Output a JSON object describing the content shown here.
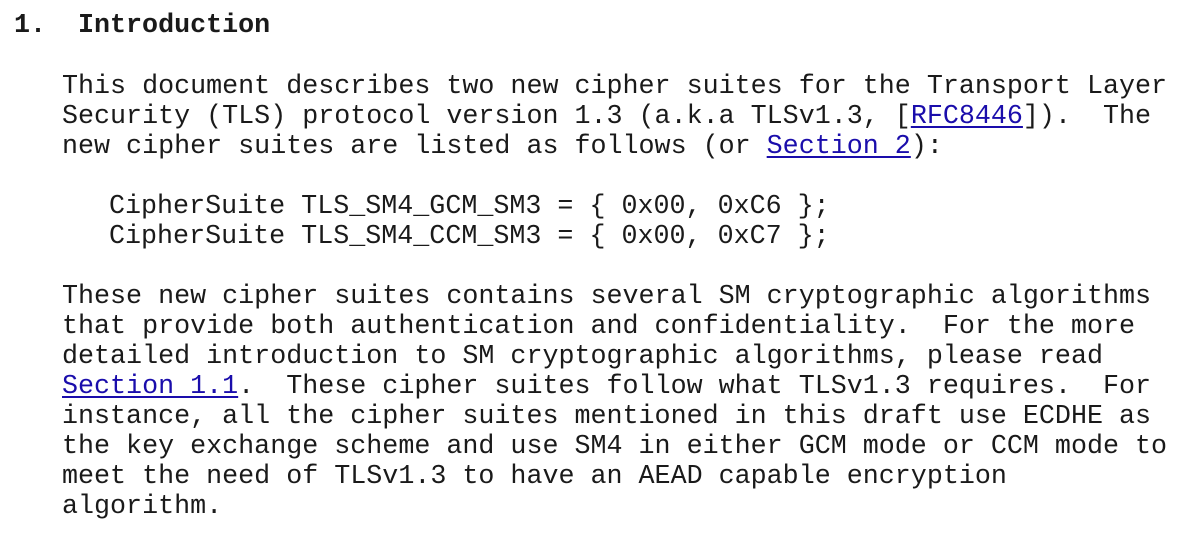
{
  "section": {
    "number": "1.",
    "title": "Introduction"
  },
  "para1": {
    "l1": "This document describes two new cipher suites for the Transport Layer",
    "l2_pre": "Security (TLS) protocol version 1.3 (a.k.a TLSv1.3, [",
    "l2_link": "RFC8446",
    "l2_post": "]).  The",
    "l3_pre": "new cipher suites are listed as follows (or ",
    "l3_link": "Section 2",
    "l3_post": "):"
  },
  "code": {
    "l1": "CipherSuite TLS_SM4_GCM_SM3 = { 0x00, 0xC6 };",
    "l2": "CipherSuite TLS_SM4_CCM_SM3 = { 0x00, 0xC7 };"
  },
  "para2": {
    "l1": "These new cipher suites contains several SM cryptographic algorithms",
    "l2": "that provide both authentication and confidentiality.  For the more",
    "l3": "detailed introduction to SM cryptographic algorithms, please read",
    "l4_link": "Section 1.1",
    "l4_post": ".  These cipher suites follow what TLSv1.3 requires.  For",
    "l5": "instance, all the cipher suites mentioned in this draft use ECDHE as",
    "l6": "the key exchange scheme and use SM4 in either GCM mode or CCM mode to",
    "l7": "meet the need of TLSv1.3 to have an AEAD capable encryption",
    "l8": "algorithm."
  },
  "colors": {
    "text": "#1a1a1a",
    "link": "#1a0dab",
    "background": "#ffffff"
  }
}
